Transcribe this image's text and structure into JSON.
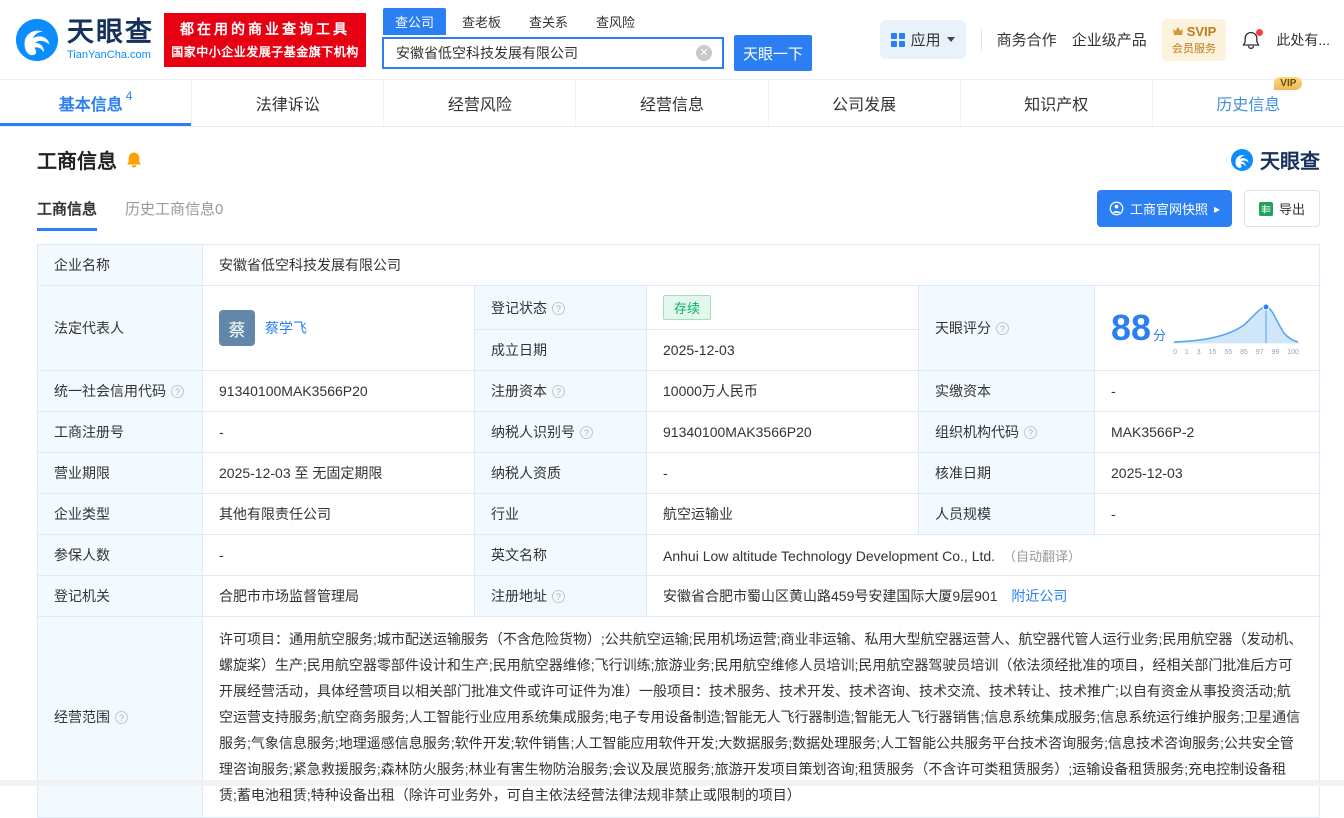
{
  "colors": {
    "accent_blue": "#2b7ff2",
    "brand_red": "#e60012",
    "status_green": "#00b368",
    "vip_gold": "#efb959",
    "label_cell_bg": "#f3faff"
  },
  "brand": {
    "name": "天眼查",
    "domain": "TianYanCha.com"
  },
  "header": {
    "promo_line1": "都在用的商业查询工具",
    "promo_line2": "国家中小企业发展子基金旗下机构",
    "search_tabs": [
      "查公司",
      "查老板",
      "查关系",
      "查风险"
    ],
    "search_value": "安徽省低空科技发展有限公司",
    "search_button": "天眼一下",
    "app_label": "应用",
    "nav": [
      "商务合作",
      "企业级产品"
    ],
    "svip_title": "SVIP",
    "svip_sub": "会员服务",
    "more": "此处有..."
  },
  "tabs": {
    "items": [
      {
        "label": "基本信息",
        "badge": "4"
      },
      {
        "label": "法律诉讼"
      },
      {
        "label": "经营风险"
      },
      {
        "label": "经营信息"
      },
      {
        "label": "公司发展"
      },
      {
        "label": "知识产权"
      },
      {
        "label": "历史信息",
        "tag": "VIP"
      }
    ]
  },
  "section": {
    "title": "工商信息",
    "subtab_active": "工商信息",
    "subtab_history": "历史工商信息0",
    "snapshot": "工商官网快照",
    "export": "导出"
  },
  "info": {
    "company_name_label": "企业名称",
    "company_name": "安徽省低空科技发展有限公司",
    "legal_rep_label": "法定代表人",
    "legal_rep_avatar": "蔡",
    "legal_rep": "蔡学飞",
    "reg_status_label": "登记状态",
    "reg_status": "存续",
    "score_label": "天眼评分",
    "score": "88",
    "score_unit": "分",
    "est_date_label": "成立日期",
    "est_date": "2025-12-03",
    "credit_code_label": "统一社会信用代码",
    "credit_code": "91340100MAK3566P20",
    "reg_capital_label": "注册资本",
    "reg_capital": "10000万人民币",
    "paid_capital_label": "实缴资本",
    "paid_capital": "-",
    "reg_no_label": "工商注册号",
    "reg_no": "-",
    "tax_id_label": "纳税人识别号",
    "tax_id": "91340100MAK3566P20",
    "org_code_label": "组织机构代码",
    "org_code": "MAK3566P-2",
    "term_label": "营业期限",
    "term": "2025-12-03 至 无固定期限",
    "tax_qual_label": "纳税人资质",
    "tax_qual": "-",
    "approval_date_label": "核准日期",
    "approval_date": "2025-12-03",
    "company_type_label": "企业类型",
    "company_type": "其他有限责任公司",
    "industry_label": "行业",
    "industry": "航空运输业",
    "staff_size_label": "人员规模",
    "staff_size": "-",
    "insured_label": "参保人数",
    "insured": "-",
    "en_name_label": "英文名称",
    "en_name": "Anhui Low altitude Technology Development Co., Ltd.",
    "en_name_note": "（自动翻译）",
    "reg_authority_label": "登记机关",
    "reg_authority": "合肥市市场监督管理局",
    "address_label": "注册地址",
    "address": "安徽省合肥市蜀山区黄山路459号安建国际大厦9层901",
    "address_link": "附近公司",
    "scope_label": "经营范围",
    "scope": "许可项目：通用航空服务;城市配送运输服务（不含危险货物）;公共航空运输;民用机场运营;商业非运输、私用大型航空器运营人、航空器代管人运行业务;民用航空器（发动机、螺旋桨）生产;民用航空器零部件设计和生产;民用航空器维修;飞行训练;旅游业务;民用航空维修人员培训;民用航空器驾驶员培训（依法须经批准的项目，经相关部门批准后方可开展经营活动，具体经营项目以相关部门批准文件或许可证件为准）一般项目：技术服务、技术开发、技术咨询、技术交流、技术转让、技术推广;以自有资金从事投资活动;航空运营支持服务;航空商务服务;人工智能行业应用系统集成服务;电子专用设备制造;智能无人飞行器制造;智能无人飞行器销售;信息系统集成服务;信息系统运行维护服务;卫星通信服务;气象信息服务;地理遥感信息服务;软件开发;软件销售;人工智能应用软件开发;大数据服务;数据处理服务;人工智能公共服务平台技术咨询服务;信息技术咨询服务;公共安全管理咨询服务;紧急救援服务;森林防火服务;林业有害生物防治服务;会议及展览服务;旅游开发项目策划咨询;租赁服务（不含许可类租赁服务）;运输设备租赁服务;充电控制设备租赁;蓄电池租赁;特种设备出租（除许可业务外，可自主依法经营法律法规非禁止或限制的项目）"
  },
  "score_chart": {
    "ticks": [
      "0",
      "1",
      "3",
      "15",
      "55",
      "85",
      "97",
      "99",
      "100"
    ]
  }
}
